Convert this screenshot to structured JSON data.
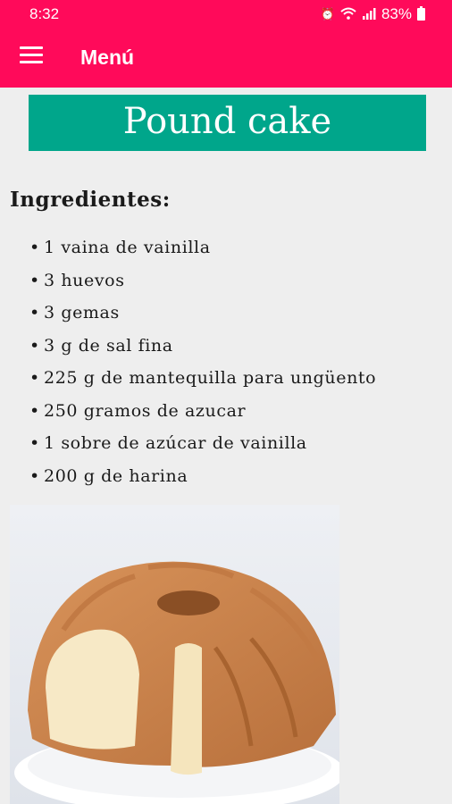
{
  "status_bar": {
    "time": "8:32",
    "battery": "83%"
  },
  "app_bar": {
    "title": "Menú"
  },
  "recipe": {
    "name": "Pound cake",
    "ingredients_heading": "Ingredientes:",
    "ingredients": [
      "1 vaina de vainilla",
      "3 huevos",
      "3 gemas",
      "3 g de sal fina",
      "225 g de mantequilla para ungüento",
      "250 gramos de azucar",
      "1 sobre de azúcar de vainilla",
      "200 g de harina"
    ]
  },
  "colors": {
    "accent": "#ff0a5a",
    "banner": "#00a68b"
  },
  "icons": {
    "menu": "hamburger-menu-icon",
    "alarm": "alarm-icon",
    "wifi": "wifi-icon",
    "signal": "signal-icon",
    "battery": "battery-icon"
  }
}
